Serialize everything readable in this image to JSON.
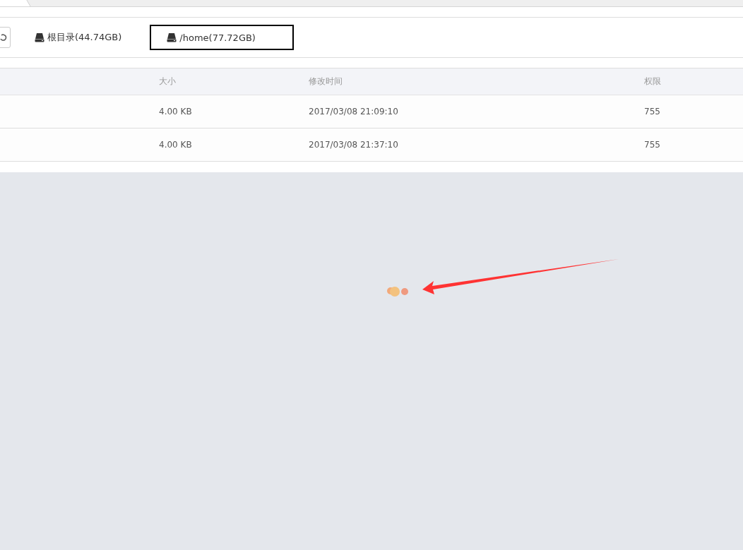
{
  "disks": [
    {
      "label": "根目录(44.74GB)",
      "selected": false
    },
    {
      "label": "/home(77.72GB)",
      "selected": true
    }
  ],
  "table": {
    "columns": [
      "大小",
      "修改时间",
      "权限"
    ],
    "rows": [
      {
        "size": "4.00 KB",
        "modified": "2017/03/08 21:09:10",
        "permission": "755"
      },
      {
        "size": "4.00 KB",
        "modified": "2017/03/08 21:37:10",
        "permission": "755"
      }
    ]
  },
  "loading": true
}
